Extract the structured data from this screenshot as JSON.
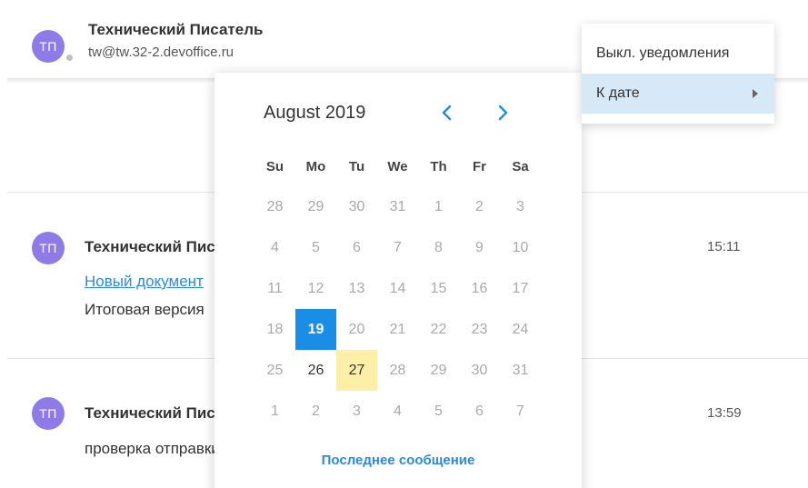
{
  "header": {
    "avatar_initials": "ТП",
    "user_name": "Технический Писатель",
    "user_email": "tw@tw.32-2.devoffice.ru"
  },
  "messages": [
    {
      "avatar_initials": "ТП",
      "author": "Технический Писатель",
      "link": "Новый документ",
      "text": "Итоговая версия",
      "time": "15:11"
    },
    {
      "avatar_initials": "ТП",
      "author": "Технический Писатель",
      "text": "проверка отправки",
      "time": "13:59"
    }
  ],
  "context_menu": {
    "items": [
      {
        "label": "Выкл. уведомления"
      },
      {
        "label": "К дате"
      }
    ]
  },
  "calendar": {
    "month_title": "August 2019",
    "prev_icon": "chevron-left-icon",
    "next_icon": "chevron-right-icon",
    "weekdays": [
      "Su",
      "Mo",
      "Tu",
      "We",
      "Th",
      "Fr",
      "Sa"
    ],
    "weeks": [
      [
        "28",
        "29",
        "30",
        "31",
        "1",
        "2",
        "3"
      ],
      [
        "4",
        "5",
        "6",
        "7",
        "8",
        "9",
        "10"
      ],
      [
        "11",
        "12",
        "13",
        "14",
        "15",
        "16",
        "17"
      ],
      [
        "18",
        "19",
        "20",
        "21",
        "22",
        "23",
        "24"
      ],
      [
        "25",
        "26",
        "27",
        "28",
        "29",
        "30",
        "31"
      ],
      [
        "1",
        "2",
        "3",
        "4",
        "5",
        "6",
        "7"
      ]
    ],
    "selected_day": "19",
    "today_day": "27",
    "footer_link": "Последнее сообщение"
  },
  "colors": {
    "avatar_bg": "#8f7be8",
    "accent": "#1a8ee6",
    "link": "#2d8ad8",
    "today_highlight": "#fcefa8",
    "menu_active": "#d7e8f7"
  }
}
